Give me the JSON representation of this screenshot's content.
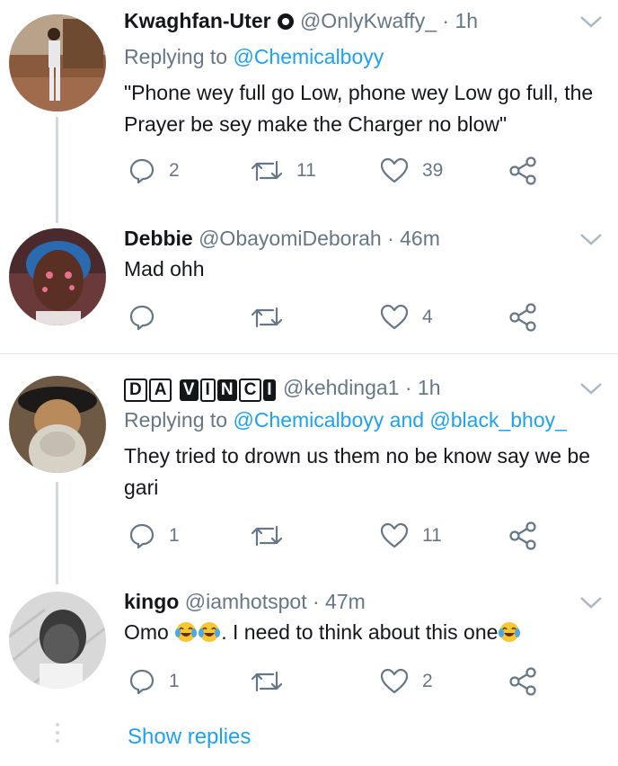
{
  "tweets": [
    {
      "name": "Kwaghfan-Uter",
      "handle": "@OnlyKwaffy_",
      "dot": "·",
      "time": "1h",
      "reply_prefix": "Replying to",
      "reply_mentions": "@Chemicalboyy",
      "text": "\"Phone wey full go Low, phone wey Low go full, the Prayer be sey make the Charger no blow\"",
      "replies": "2",
      "retweets": "11",
      "likes": "39"
    },
    {
      "name": "Debbie",
      "handle": "@ObayomiDeborah",
      "dot": "·",
      "time": "46m",
      "text": "Mad ohh",
      "replies": "",
      "retweets": "",
      "likes": "4"
    },
    {
      "name_badges": [
        "D",
        "A",
        "V",
        "I",
        "N",
        "C",
        "I"
      ],
      "handle": "@kehdinga1",
      "dot": "·",
      "time": "1h",
      "reply_prefix": "Replying to",
      "reply_mention_1": "@Chemicalboyy",
      "reply_and": "and",
      "reply_mention_2": "@black_bhoy_",
      "text": "They tried to drown us them no be know say we be gari",
      "replies": "1",
      "retweets": "",
      "likes": "11"
    },
    {
      "name": "kingo",
      "handle": "@iamhotspot",
      "dot": "·",
      "time": "47m",
      "text_part1": "Omo ",
      "text_part2": ". I need to think about this one",
      "emoji": "face-with-tears-of-joy",
      "replies": "1",
      "retweets": "",
      "likes": "2"
    }
  ],
  "show_replies": "Show replies",
  "colors": {
    "accent": "#1da1f2",
    "muted": "#657786",
    "text": "#14171a",
    "divider": "#e1e8ed",
    "thread": "#cfd9de"
  },
  "icons": [
    "reply-icon",
    "retweet-icon",
    "like-icon",
    "share-icon",
    "chevron-down-icon",
    "verified-badge-icon"
  ]
}
